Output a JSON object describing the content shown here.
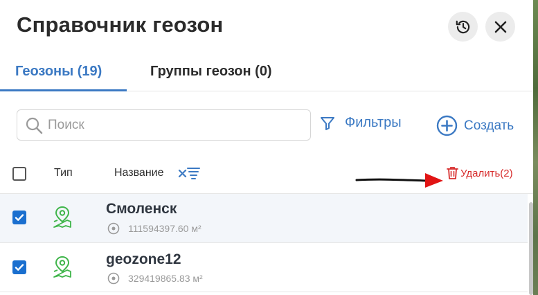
{
  "header": {
    "title": "Справочник геозон"
  },
  "header_buttons": {
    "history_icon": "history-icon",
    "close_icon": "close-icon"
  },
  "tabs": [
    {
      "label": "Геозоны (19)",
      "active": true
    },
    {
      "label": "Группы геозон (0)",
      "active": false
    }
  ],
  "toolbar": {
    "search_placeholder": "Поиск",
    "filters_label": "Фильтры",
    "create_label": "Создать"
  },
  "table": {
    "columns": {
      "type": "Тип",
      "name": "Название"
    },
    "delete_label": "Удалить(2)",
    "rows": [
      {
        "name": "Смоленск",
        "area": "111594397.60 м²",
        "checked": true
      },
      {
        "name": "geozone12",
        "area": "329419865.83 м²",
        "checked": true
      }
    ]
  },
  "colors": {
    "accent": "#3b79c3",
    "danger": "#d72b2b",
    "checkbox": "#1a6fcf",
    "geo_icon": "#3fb54a",
    "selected_row": "#f3f6fa"
  }
}
